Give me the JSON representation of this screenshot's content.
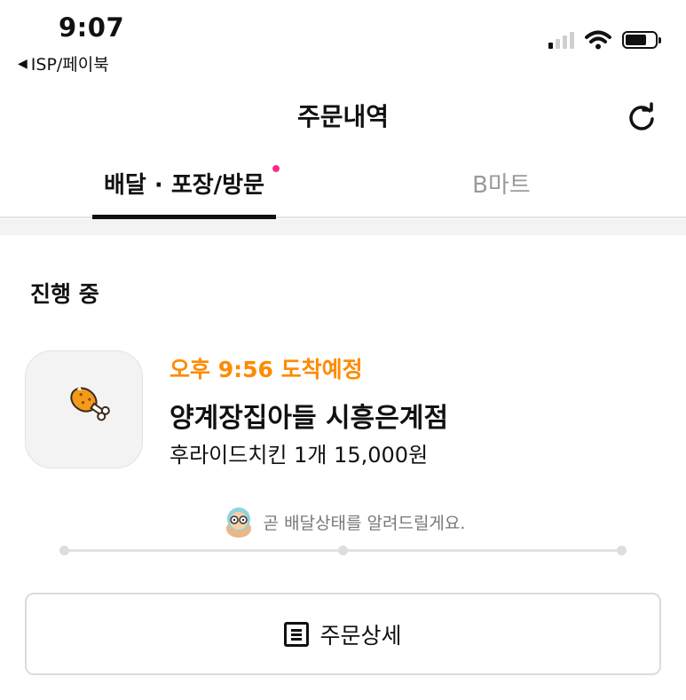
{
  "status_bar": {
    "time": "9:07",
    "back_app": "ISP/페이북"
  },
  "header": {
    "title": "주문내역"
  },
  "tabs": [
    {
      "label": "배달 · 포장/방문",
      "active": true,
      "has_new": true
    },
    {
      "label": "B마트",
      "active": false
    }
  ],
  "section": {
    "title": "진행 중"
  },
  "order": {
    "eta": "오후 9:56 도착예정",
    "store_name": "양계장집아들 시흥은계점",
    "summary": "후라이드치킨 1개 15,000원",
    "notice": "곧 배달상태를 알려드릴게요.",
    "progress_fraction": 0
  },
  "detail_button": {
    "label": "주문상세"
  },
  "colors": {
    "accent_orange": "#ff8a00",
    "tab_dot": "#ff2d8a",
    "highlight_mint": "#bfeee6"
  },
  "icons": {
    "refresh": "refresh-icon",
    "store": "chicken-drumstick-icon",
    "mascot": "mascot-icon",
    "detail": "receipt-icon"
  }
}
